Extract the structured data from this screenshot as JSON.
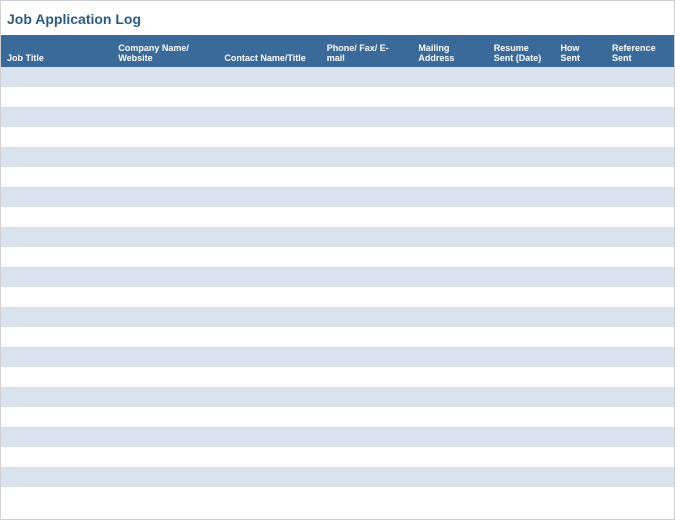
{
  "title": "Job Application Log",
  "columns": [
    {
      "label": "Job Title"
    },
    {
      "label": "Company Name/ Website"
    },
    {
      "label": "Contact Name/Title"
    },
    {
      "label": "Phone/ Fax/ E-mail"
    },
    {
      "label": "Mailing Address"
    },
    {
      "label": "Resume Sent (Date)"
    },
    {
      "label": "How  Sent"
    },
    {
      "label": "Reference Sent"
    }
  ],
  "rows": [
    {},
    {},
    {},
    {},
    {},
    {},
    {},
    {},
    {},
    {},
    {},
    {},
    {},
    {},
    {},
    {},
    {},
    {},
    {},
    {},
    {},
    {}
  ]
}
